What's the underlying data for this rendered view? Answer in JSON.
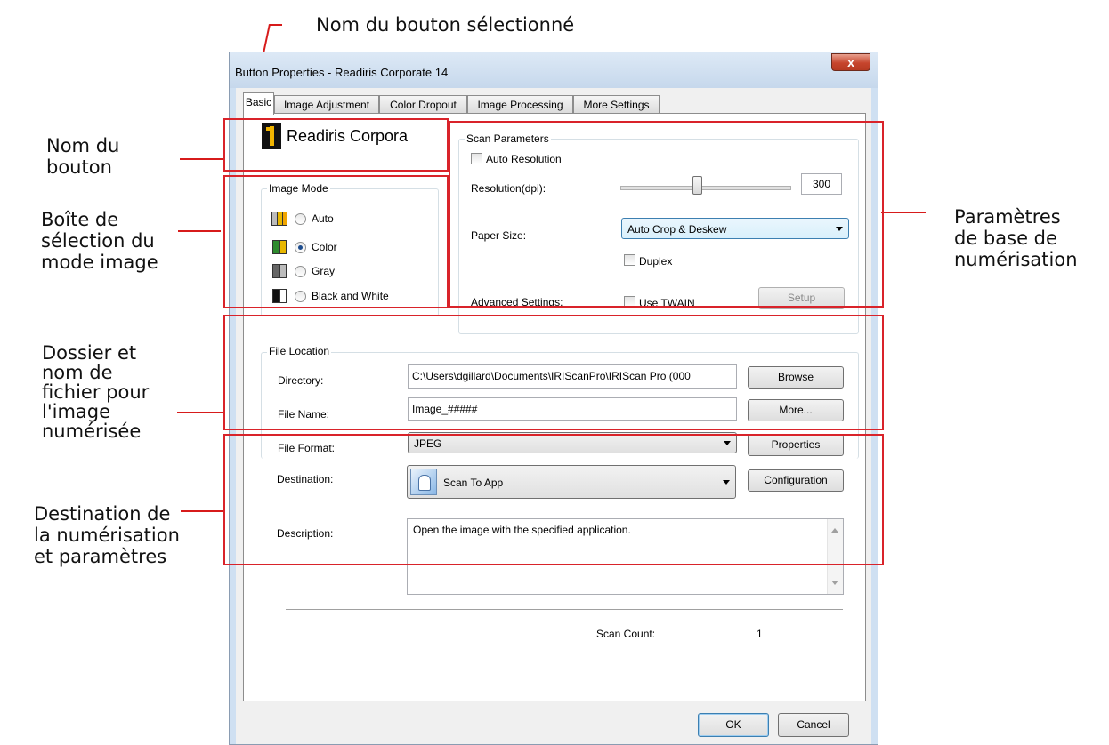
{
  "callouts": {
    "selected_button_name": "Nom du bouton sélectionné",
    "button_name": [
      "Nom du",
      "bouton"
    ],
    "image_mode_box": [
      "Boîte de",
      "sélection du",
      "mode image"
    ],
    "basic_scan_params": [
      "Paramètres",
      "de base de",
      "numérisation"
    ],
    "folder_filename": [
      "Dossier et",
      "nom de",
      "fichier pour",
      "l'image",
      "numérisée"
    ],
    "destination": [
      "Destination de",
      "la numérisation",
      "et paramètres"
    ]
  },
  "window": {
    "title": "Button Properties - Readiris Corporate 14",
    "close_glyph": "x"
  },
  "tabs": [
    {
      "label": "Basic",
      "active": true
    },
    {
      "label": "Image Adjustment",
      "active": false
    },
    {
      "label": "Color Dropout",
      "active": false
    },
    {
      "label": "Image Processing",
      "active": false
    },
    {
      "label": "More Settings",
      "active": false
    }
  ],
  "button_name": {
    "text": "Readiris Corpora",
    "icon": "number-1-icon"
  },
  "image_mode": {
    "title": "Image Mode",
    "options": [
      {
        "label": "Auto",
        "selected": false,
        "icon": "auto-mode-icon"
      },
      {
        "label": "Color",
        "selected": true,
        "icon": "color-mode-icon"
      },
      {
        "label": "Gray",
        "selected": false,
        "icon": "gray-mode-icon"
      },
      {
        "label": "Black and White",
        "selected": false,
        "icon": "bw-mode-icon"
      }
    ]
  },
  "scan_params": {
    "title": "Scan Parameters",
    "auto_resolution_label": "Auto Resolution",
    "auto_resolution_checked": false,
    "resolution_label": "Resolution(dpi):",
    "resolution_value": "300",
    "paper_size_label": "Paper Size:",
    "paper_size_value": "Auto Crop & Deskew",
    "duplex_label": "Duplex",
    "duplex_checked": false,
    "advanced_label": "Advanced Settings:",
    "use_twain_label": "Use TWAIN",
    "use_twain_checked": false,
    "setup_label": "Setup"
  },
  "file_location": {
    "title": "File Location",
    "directory_label": "Directory:",
    "directory_value": "C:\\Users\\dgillard\\Documents\\IRIScanPro\\IRIScan Pro (000",
    "browse_label": "Browse",
    "filename_label": "File Name:",
    "filename_value": "Image_#####",
    "more_label": "More...",
    "format_label": "File Format:",
    "format_value": "JPEG",
    "properties_label": "Properties"
  },
  "destination": {
    "label": "Destination:",
    "value": "Scan To App",
    "configuration_label": "Configuration",
    "description_label": "Description:",
    "description_value": "Open the image with the specified application."
  },
  "scan_count": {
    "label": "Scan Count:",
    "value": "1"
  },
  "footer": {
    "ok_label": "OK",
    "cancel_label": "Cancel"
  },
  "colors": {
    "callout_red": "#d9232a",
    "selection_blue": "#3399ff"
  }
}
